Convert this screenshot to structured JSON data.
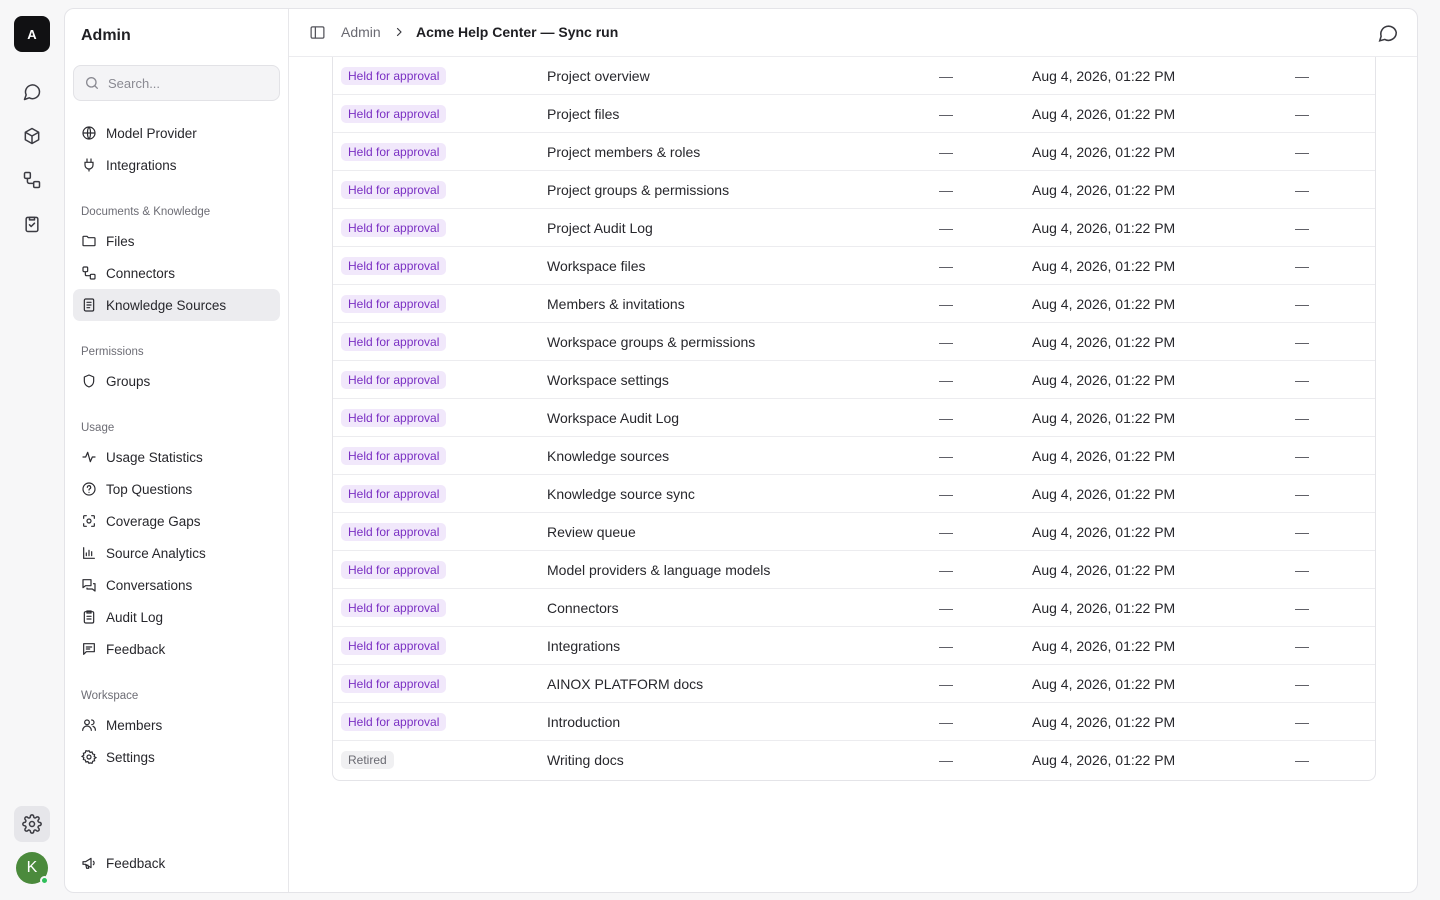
{
  "rail": {
    "logo_letter": "A",
    "avatar_letter": "K"
  },
  "sidebar": {
    "title": "Admin",
    "search_placeholder": "Search...",
    "top_items": [
      {
        "label": "Model Provider",
        "icon": "globe-icon"
      },
      {
        "label": "Integrations",
        "icon": "plug-icon"
      }
    ],
    "sections": [
      {
        "title": "Documents & Knowledge",
        "items": [
          {
            "label": "Files",
            "icon": "folder-icon"
          },
          {
            "label": "Connectors",
            "icon": "connectors-icon"
          },
          {
            "label": "Knowledge Sources",
            "icon": "book-icon",
            "active": true
          }
        ]
      },
      {
        "title": "Permissions",
        "items": [
          {
            "label": "Groups",
            "icon": "shield-icon"
          }
        ]
      },
      {
        "title": "Usage",
        "items": [
          {
            "label": "Usage Statistics",
            "icon": "activity-icon"
          },
          {
            "label": "Top Questions",
            "icon": "question-icon"
          },
          {
            "label": "Coverage Gaps",
            "icon": "scan-icon"
          },
          {
            "label": "Source Analytics",
            "icon": "bar-chart-icon"
          },
          {
            "label": "Conversations",
            "icon": "chats-icon"
          },
          {
            "label": "Audit Log",
            "icon": "clipboard-icon"
          },
          {
            "label": "Feedback",
            "icon": "message-square-icon"
          }
        ]
      },
      {
        "title": "Workspace",
        "items": [
          {
            "label": "Members",
            "icon": "users-icon"
          },
          {
            "label": "Settings",
            "icon": "gear-icon"
          }
        ]
      }
    ],
    "footer_feedback": "Feedback"
  },
  "header": {
    "breadcrumb_root": "Admin",
    "breadcrumb_current": "Acme Help Center — Sync run"
  },
  "table": {
    "rows": [
      {
        "status": "Held for approval",
        "kind": "held",
        "name": "Project overview",
        "col3": "—",
        "date": "Aug 4, 2026, 01:22 PM",
        "col5": "—"
      },
      {
        "status": "Held for approval",
        "kind": "held",
        "name": "Project files",
        "col3": "—",
        "date": "Aug 4, 2026, 01:22 PM",
        "col5": "—"
      },
      {
        "status": "Held for approval",
        "kind": "held",
        "name": "Project members & roles",
        "col3": "—",
        "date": "Aug 4, 2026, 01:22 PM",
        "col5": "—"
      },
      {
        "status": "Held for approval",
        "kind": "held",
        "name": "Project groups & permissions",
        "col3": "—",
        "date": "Aug 4, 2026, 01:22 PM",
        "col5": "—"
      },
      {
        "status": "Held for approval",
        "kind": "held",
        "name": "Project Audit Log",
        "col3": "—",
        "date": "Aug 4, 2026, 01:22 PM",
        "col5": "—"
      },
      {
        "status": "Held for approval",
        "kind": "held",
        "name": "Workspace files",
        "col3": "—",
        "date": "Aug 4, 2026, 01:22 PM",
        "col5": "—"
      },
      {
        "status": "Held for approval",
        "kind": "held",
        "name": "Members & invitations",
        "col3": "—",
        "date": "Aug 4, 2026, 01:22 PM",
        "col5": "—"
      },
      {
        "status": "Held for approval",
        "kind": "held",
        "name": "Workspace groups & permissions",
        "col3": "—",
        "date": "Aug 4, 2026, 01:22 PM",
        "col5": "—"
      },
      {
        "status": "Held for approval",
        "kind": "held",
        "name": "Workspace settings",
        "col3": "—",
        "date": "Aug 4, 2026, 01:22 PM",
        "col5": "—"
      },
      {
        "status": "Held for approval",
        "kind": "held",
        "name": "Workspace Audit Log",
        "col3": "—",
        "date": "Aug 4, 2026, 01:22 PM",
        "col5": "—"
      },
      {
        "status": "Held for approval",
        "kind": "held",
        "name": "Knowledge sources",
        "col3": "—",
        "date": "Aug 4, 2026, 01:22 PM",
        "col5": "—"
      },
      {
        "status": "Held for approval",
        "kind": "held",
        "name": "Knowledge source sync",
        "col3": "—",
        "date": "Aug 4, 2026, 01:22 PM",
        "col5": "—"
      },
      {
        "status": "Held for approval",
        "kind": "held",
        "name": "Review queue",
        "col3": "—",
        "date": "Aug 4, 2026, 01:22 PM",
        "col5": "—"
      },
      {
        "status": "Held for approval",
        "kind": "held",
        "name": "Model providers & language models",
        "col3": "—",
        "date": "Aug 4, 2026, 01:22 PM",
        "col5": "—"
      },
      {
        "status": "Held for approval",
        "kind": "held",
        "name": "Connectors",
        "col3": "—",
        "date": "Aug 4, 2026, 01:22 PM",
        "col5": "—"
      },
      {
        "status": "Held for approval",
        "kind": "held",
        "name": "Integrations",
        "col3": "—",
        "date": "Aug 4, 2026, 01:22 PM",
        "col5": "—"
      },
      {
        "status": "Held for approval",
        "kind": "held",
        "name": "AINOX PLATFORM docs",
        "col3": "—",
        "date": "Aug 4, 2026, 01:22 PM",
        "col5": "—"
      },
      {
        "status": "Held for approval",
        "kind": "held",
        "name": "Introduction",
        "col3": "—",
        "date": "Aug 4, 2026, 01:22 PM",
        "col5": "—"
      },
      {
        "status": "Retired",
        "kind": "retired",
        "name": "Writing docs",
        "col3": "—",
        "date": "Aug 4, 2026, 01:22 PM",
        "col5": "—"
      }
    ]
  }
}
